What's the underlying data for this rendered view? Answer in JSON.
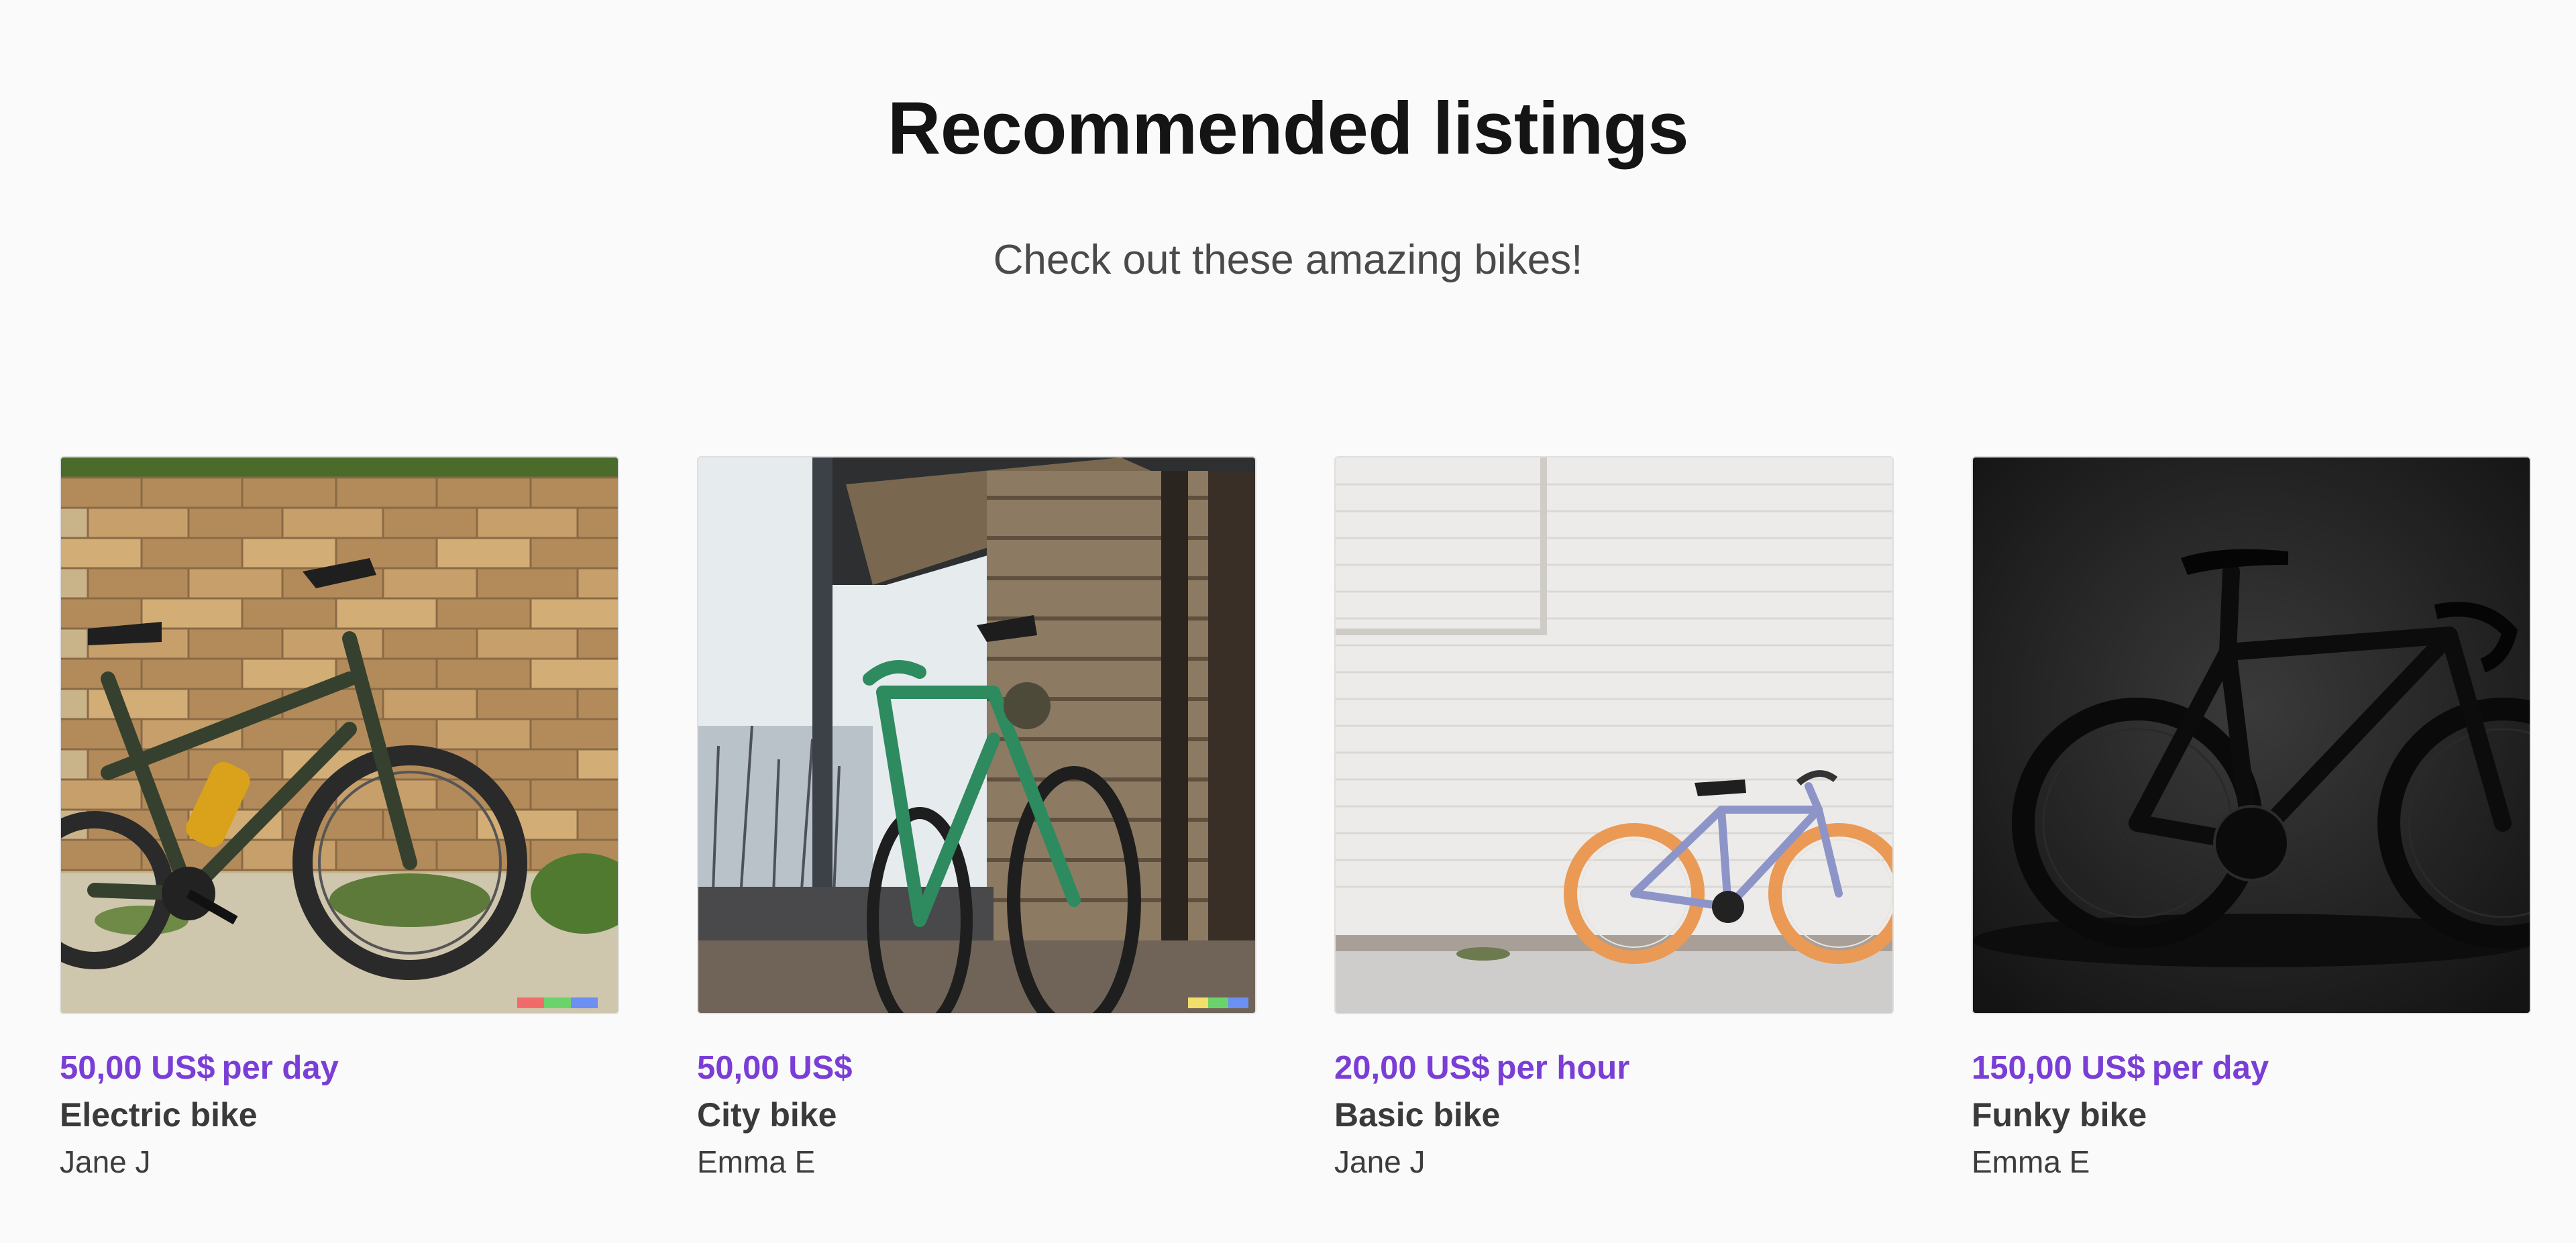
{
  "header": {
    "title": "Recommended listings",
    "subtitle": "Check out these amazing bikes!"
  },
  "listings": [
    {
      "price": "50,00 US$",
      "unit": "per day",
      "title": "Electric bike",
      "author": "Jane J",
      "image": "electric-bike-photo"
    },
    {
      "price": "50,00 US$",
      "unit": "",
      "title": "City bike",
      "author": "Emma E",
      "image": "city-bike-photo"
    },
    {
      "price": "20,00 US$",
      "unit": "per hour",
      "title": "Basic bike",
      "author": "Jane J",
      "image": "basic-bike-photo"
    },
    {
      "price": "150,00 US$",
      "unit": "per day",
      "title": "Funky bike",
      "author": "Emma E",
      "image": "funky-bike-photo"
    }
  ],
  "colors": {
    "background": "#fafafa",
    "accent_price": "#7a3ed6",
    "title_text": "#141414",
    "body_text": "#3a3a3a"
  }
}
